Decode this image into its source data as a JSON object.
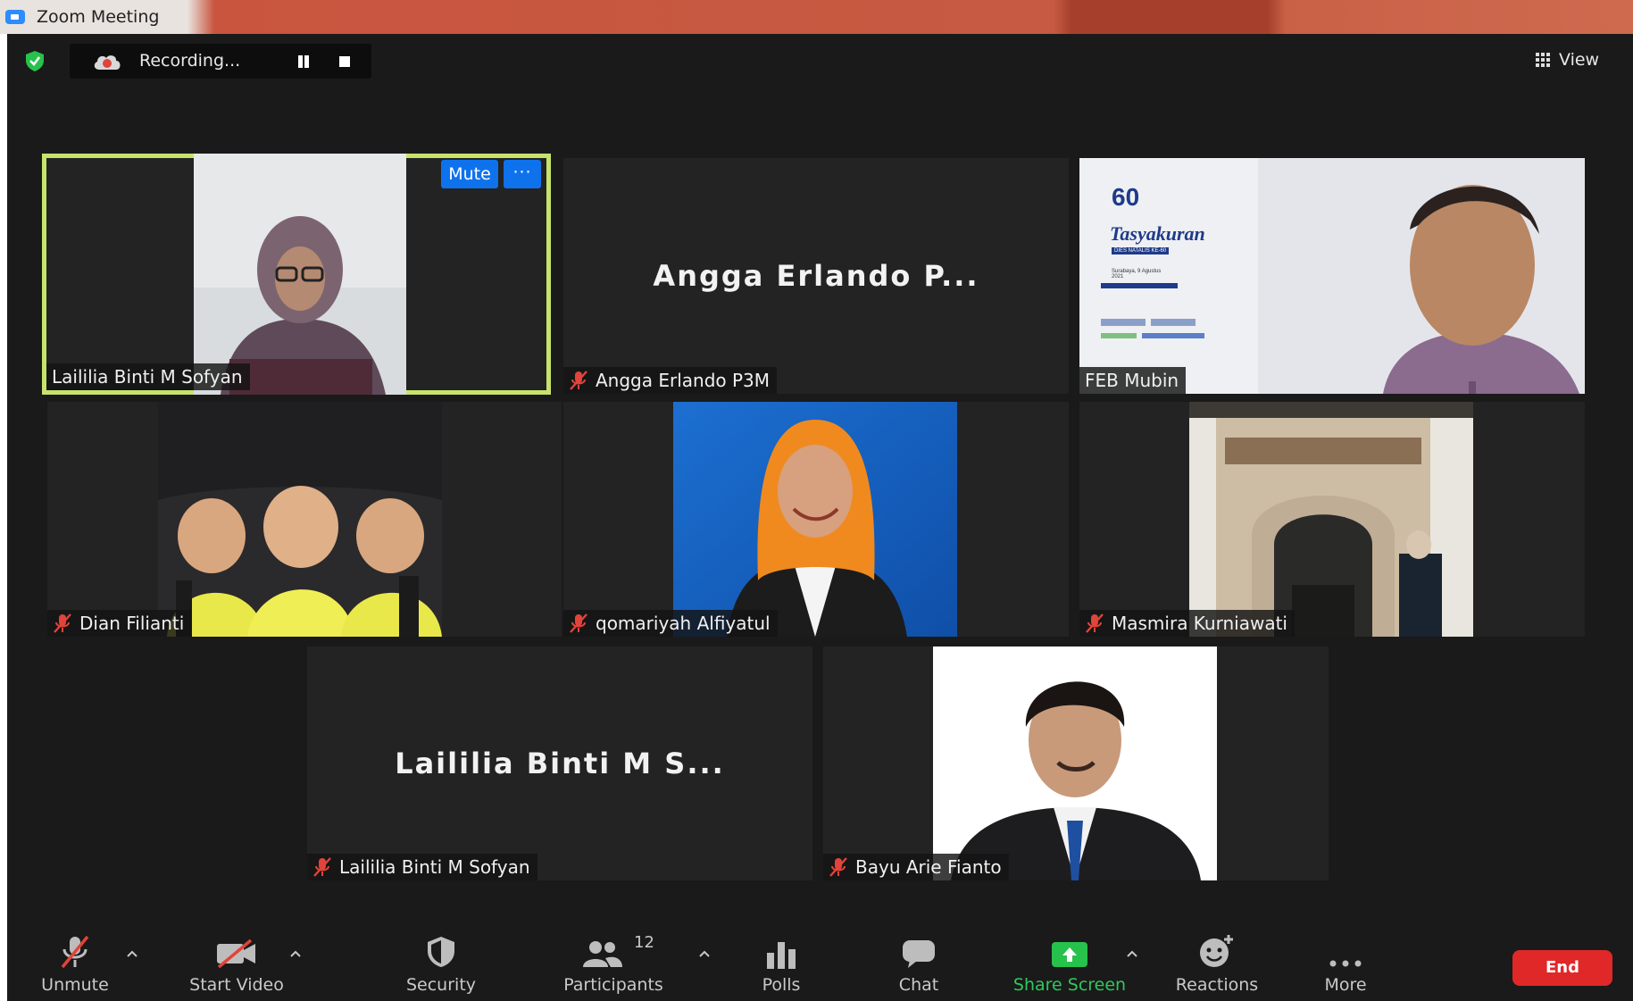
{
  "window": {
    "title": "Zoom Meeting"
  },
  "recording": {
    "label": "Recording..."
  },
  "view": {
    "label": "View"
  },
  "tiles": [
    {
      "name": "Laililia Binti M Sofyan",
      "video": true,
      "active": true,
      "muted": false
    },
    {
      "name": "Angga Erlando P3M",
      "big_name": "Angga Erlando P...",
      "video": false,
      "muted": true
    },
    {
      "name": "FEB Mubin",
      "video": true,
      "muted": false
    },
    {
      "name": "Dian Filianti",
      "video": true,
      "muted": true
    },
    {
      "name": "qomariyah Alfiyatul",
      "video": true,
      "muted": true
    },
    {
      "name": "Masmira Kurniawati",
      "video": true,
      "muted": true
    },
    {
      "name": "Laililia Binti M Sofyan",
      "big_name": "Laililia Binti M S...",
      "video": false,
      "muted": true
    },
    {
      "name": "Bayu Arie Fianto",
      "video": true,
      "muted": true
    }
  ],
  "tile_actions": {
    "mute": "Mute",
    "more": "···"
  },
  "shared_slide": {
    "logo_number": "60",
    "heading": "Tasyakuran",
    "subheading": "DIES NATALIS KE-60",
    "place_date": "Surabaya, 9 Agustus 2021"
  },
  "toolbar": {
    "unmute": "Unmute",
    "start_video": "Start Video",
    "security": "Security",
    "participants": "Participants",
    "participant_count": "12",
    "polls": "Polls",
    "chat": "Chat",
    "share_screen": "Share Screen",
    "reactions": "Reactions",
    "more": "More",
    "end": "End"
  },
  "colors": {
    "background": "#1a1a1a",
    "tile": "#232323",
    "active_border": "#c8e36c",
    "accent_blue": "#0e72ed",
    "share_green": "#2ec95c",
    "end_red": "#e02828",
    "muted_red": "#e0443a"
  }
}
